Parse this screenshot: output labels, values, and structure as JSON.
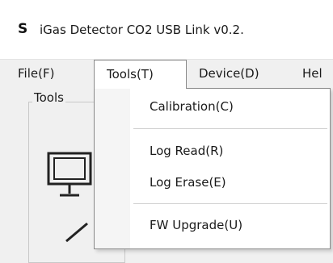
{
  "window": {
    "icon_label": "S",
    "title": "iGas Detector CO2 USB Link  v0.2."
  },
  "menubar": {
    "file": "File(F)",
    "tools": "Tools(T)",
    "device": "Device(D)",
    "help": "Hel"
  },
  "groupbox": {
    "title": "Tools"
  },
  "tools_menu": {
    "calibration": "Calibration(C)",
    "log_read": "Log Read(R)",
    "log_erase": "Log Erase(E)",
    "fw_upgrade": "FW Upgrade(U)"
  },
  "icons": {
    "monitor": "monitor-icon",
    "partial": "partial-icon"
  }
}
